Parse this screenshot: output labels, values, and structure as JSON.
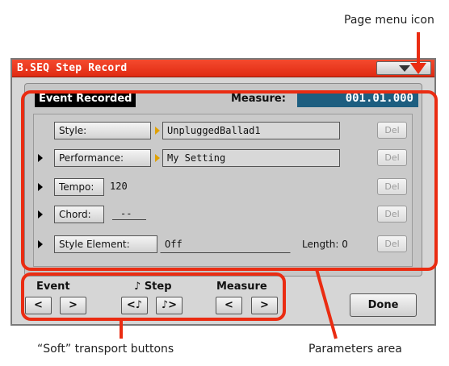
{
  "callouts": {
    "page_menu_icon": "Page menu icon",
    "soft_transport": "“Soft” transport buttons",
    "parameters_area": "Parameters area"
  },
  "page": {
    "title": "B.SEQ Step Record",
    "event_recorded": "Event Recorded",
    "measure_label": "Measure:",
    "measure_value": "001.01.000"
  },
  "rows": {
    "style": {
      "label": "Style:",
      "value": "UnpluggedBallad1",
      "del": "Del"
    },
    "performance": {
      "label": "Performance:",
      "value": "My Setting",
      "del": "Del"
    },
    "tempo": {
      "label": "Tempo:",
      "value": "120",
      "del": "Del"
    },
    "chord": {
      "label": "Chord:",
      "value": "--",
      "del": "Del"
    },
    "style_element": {
      "label": "Style Element:",
      "value": "Off",
      "length": "Length: 0",
      "del": "Del"
    }
  },
  "transport": {
    "event_label": "Event",
    "step_label": "♪ Step",
    "measure_label": "Measure",
    "event_prev": "<",
    "event_next": ">",
    "step_prev": "<♪",
    "step_next": "♪>",
    "measure_prev": "<",
    "measure_next": ">"
  },
  "done": "Done",
  "colors": {
    "title_bar": "#e8341a",
    "highlight": "#ea2c12",
    "measure_field": "#1d5e80",
    "selection_triangle": "#e0a000"
  }
}
